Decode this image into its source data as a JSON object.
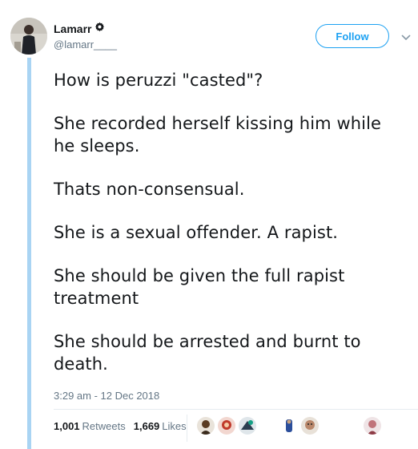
{
  "author": {
    "name": "Lamarr",
    "handle": "@lamarr____",
    "verified_icon": "gear-badge-icon"
  },
  "follow_button": {
    "label": "Follow"
  },
  "menu_icon": "chevron-down-icon",
  "tweet": {
    "paragraphs": [
      "How is peruzzi \"casted\"?",
      "She recorded herself kissing him while he sleeps.",
      "Thats non-consensual.",
      "She is a sexual offender. A rapist.",
      "She should be given the full rapist treatment",
      "She should be arrested and burnt to death."
    ],
    "timestamp": "3:29 am - 12 Dec 2018"
  },
  "stats": {
    "retweets_count": "1,001",
    "retweets_label": "Retweets",
    "likes_count": "1,669",
    "likes_label": "Likes"
  },
  "colors": {
    "accent": "#1da1f2",
    "thread_line": "#a9d4f3",
    "secondary_text": "#657786",
    "divider": "#e6ecf0"
  }
}
